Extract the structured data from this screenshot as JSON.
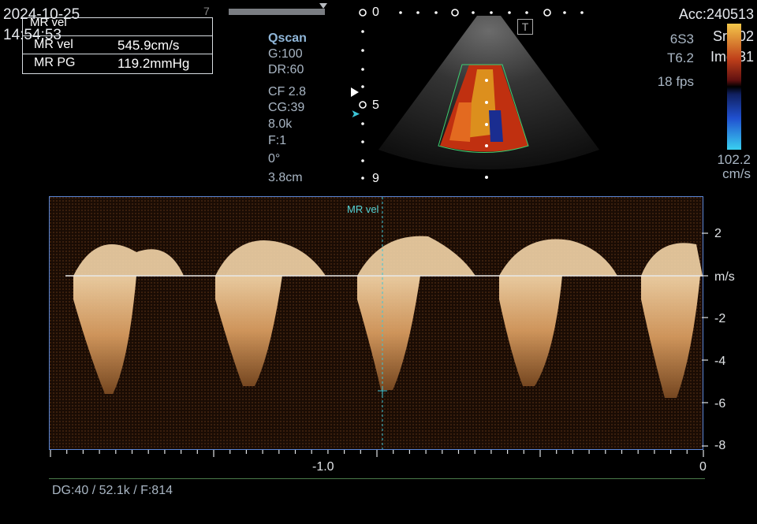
{
  "header": {
    "date": "2024-10-25",
    "time": "14:54:53",
    "top_small": "7",
    "acc": "Acc:240513",
    "srs": "Srs:02",
    "img": "Img:31",
    "probe": "6S3",
    "freq": "T6.2",
    "fps": "18 fps",
    "t_badge": "T"
  },
  "measurements": {
    "title": "MR vel",
    "rows": [
      {
        "label": "MR vel",
        "value": "545.9",
        "unit": "cm/s"
      },
      {
        "label": "MR PG",
        "value": "119.2",
        "unit": "mmHg"
      }
    ]
  },
  "scan_params": {
    "mode": "Qscan",
    "gain": "G:100",
    "dr": "DR:60",
    "cf": "CF 2.8",
    "cg": "CG:39",
    "prf": "8.0k",
    "f": "F:1",
    "angle": "0°",
    "depth": "3.8cm"
  },
  "depth_scale": {
    "labels": [
      "0",
      "5",
      "9"
    ]
  },
  "color_bar": {
    "top_value": "102.2",
    "unit": "cm/s",
    "colors": [
      "#f4c84a",
      "#c0401a",
      "#601010",
      "#000000",
      "#102060",
      "#2050d0",
      "#3ad0f0"
    ]
  },
  "doppler": {
    "cursor_label": "MR vel",
    "y_unit": "m/s",
    "y_ticks": [
      "2",
      "-2",
      "-4",
      "-6",
      "-8"
    ],
    "x_ticks": [
      "-1.0",
      "0"
    ]
  },
  "bottom": {
    "dg": "DG:40",
    "prf": "/ 52.1k",
    "f": "/ F:814"
  }
}
